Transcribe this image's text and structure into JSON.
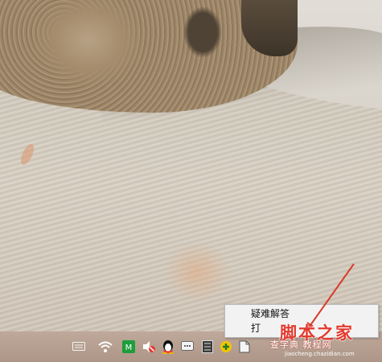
{
  "context_menu": {
    "items": [
      {
        "label": "疑难解答"
      },
      {
        "label": "打"
      }
    ]
  },
  "taskbar": {
    "tray_icons": [
      {
        "name": "keyboard-icon"
      },
      {
        "name": "wifi-icon"
      },
      {
        "name": "green-app-icon"
      },
      {
        "name": "volume-muted-icon"
      },
      {
        "name": "qq-penguin-icon"
      },
      {
        "name": "message-icon"
      },
      {
        "name": "network-device-icon"
      },
      {
        "name": "yellow-plus-icon"
      },
      {
        "name": "document-icon"
      }
    ]
  },
  "watermark": {
    "main": "脚本之家",
    "sub": "查字典 教程网",
    "url": "jiaocheng.chazidian.com"
  },
  "colors": {
    "accent_red": "#e23a2e",
    "taskbar": "#b39d8e",
    "menu_bg": "#f2f2f2"
  }
}
